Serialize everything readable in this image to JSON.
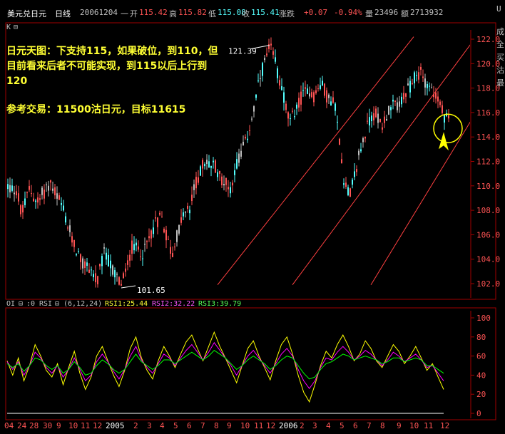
{
  "header": {
    "symbol_name": "美元兑日元",
    "period": "日线",
    "date": "20061204",
    "sep": "一",
    "open_label": "开",
    "open": "115.42",
    "high_label": "高",
    "high": "115.82",
    "low_label": "低",
    "low": "115.08",
    "close_label": "收",
    "close": "115.41",
    "change_label": "涨跌",
    "change": "+0.07",
    "change_pct": "-0.94%",
    "volume_label": "量",
    "volume": "23496",
    "amount_label": "额",
    "amount": "2713932"
  },
  "corner": {
    "k_mark": "K",
    "box_glyph": "⊟"
  },
  "right_strip": [
    "U",
    "成",
    "全",
    "买",
    "沽",
    "最"
  ],
  "annotation": {
    "line1": "日元天图：下支持115，如果破位，到110，但",
    "line2": "目前看来后者不可能实现，到115以后上行到",
    "line3": "120",
    "line4": "参考交易：11500沽日元，目标11615"
  },
  "indicator_bar": {
    "oi": "OI",
    "box1": "⊟",
    "zero": ":0",
    "rsi": "RSI",
    "box2": "⊟",
    "params": "(6,12,24)",
    "rsi1_label": "RSI1:25.44",
    "rsi2_label": "RSI2:32.22",
    "rsi3_label": "RSI3:39.79"
  },
  "colors": {
    "up": "#ff5454",
    "down": "#54ffff",
    "neutral": "#c0c0c0",
    "frame": "#a00000",
    "channel": "#ff4040",
    "axis_text": "#ff5454",
    "highlight": "#ffff00",
    "rsi1": "#ffff00",
    "rsi2": "#ff00ff",
    "rsi3": "#00ff00"
  },
  "chart_data": [
    {
      "type": "candlestick",
      "title": "",
      "price_axis": {
        "ticks": [
          "122.0",
          "120.0",
          "118.0",
          "116.0",
          "114.0",
          "112.0",
          "110.0",
          "108.0",
          "106.0",
          "104.0",
          "102.0"
        ],
        "ylim": [
          101.4,
          122.5
        ]
      },
      "labels": {
        "high_mark": "121.39",
        "low_mark": "101.65"
      },
      "price_path": [
        [
          0,
          114.6
        ],
        [
          10,
          110
        ],
        [
          22,
          109.6
        ],
        [
          30,
          107.6
        ],
        [
          40,
          109.8
        ],
        [
          52,
          108.6
        ],
        [
          62,
          109.7
        ],
        [
          70,
          110.2
        ],
        [
          85,
          108.4
        ],
        [
          100,
          105.6
        ],
        [
          115,
          103.6
        ],
        [
          126,
          103.3
        ],
        [
          135,
          102.0
        ],
        [
          145,
          104.5
        ],
        [
          158,
          103.0
        ],
        [
          170,
          101.9
        ],
        [
          185,
          105.1
        ],
        [
          200,
          104.5
        ],
        [
          215,
          106.8
        ],
        [
          225,
          107.6
        ],
        [
          235,
          105.4
        ],
        [
          240,
          104.3
        ],
        [
          255,
          107.6
        ],
        [
          265,
          108.0
        ],
        [
          272,
          110.0
        ],
        [
          285,
          111.9
        ],
        [
          300,
          111.6
        ],
        [
          315,
          110.2
        ],
        [
          322,
          109.8
        ],
        [
          332,
          112.1
        ],
        [
          345,
          113.8
        ],
        [
          355,
          116.3
        ],
        [
          362,
          118.4
        ],
        [
          370,
          120.1
        ],
        [
          378,
          121.3
        ],
        [
          386,
          119.8
        ],
        [
          395,
          117.9
        ],
        [
          405,
          115.0
        ],
        [
          412,
          116.1
        ],
        [
          420,
          117.0
        ],
        [
          430,
          118.0
        ],
        [
          440,
          117.4
        ],
        [
          450,
          118.3
        ],
        [
          460,
          117.1
        ],
        [
          468,
          116.7
        ],
        [
          475,
          113.8
        ],
        [
          482,
          110.1
        ],
        [
          490,
          109.4
        ],
        [
          497,
          111.1
        ],
        [
          505,
          113.1
        ],
        [
          515,
          115.1
        ],
        [
          525,
          116.0
        ],
        [
          535,
          115.1
        ],
        [
          545,
          116.2
        ],
        [
          555,
          116.7
        ],
        [
          565,
          117.0
        ],
        [
          575,
          118.3
        ],
        [
          583,
          118.9
        ],
        [
          590,
          119.4
        ],
        [
          597,
          118.4
        ],
        [
          605,
          117.9
        ],
        [
          612,
          117.0
        ],
        [
          618,
          116.3
        ],
        [
          622,
          115.4
        ]
      ],
      "lows": [
        {
          "candle_x": 170,
          "price": 101.65
        }
      ],
      "highs": [
        {
          "candle_x": 378,
          "price": 121.39
        }
      ],
      "channel_lines": [
        {
          "from": [
            305,
            101.9
          ],
          "to": [
            580,
            122.2
          ]
        },
        {
          "from": [
            410,
            101.9
          ],
          "to": [
            660,
            121.6
          ]
        },
        {
          "from": [
            520,
            101.9
          ],
          "to": [
            660,
            115.3
          ]
        }
      ],
      "highlight_circle": {
        "center": [
          628,
          114.7
        ],
        "label": "target"
      }
    },
    {
      "type": "line",
      "title": "",
      "series": [
        {
          "name": "RSI1",
          "values_note": "oscillator",
          "values": [
            55,
            40,
            58,
            34,
            50,
            72,
            60,
            45,
            38,
            52,
            30,
            48,
            65,
            42,
            25,
            38,
            60,
            70,
            55,
            40,
            28,
            45,
            68,
            80,
            58,
            45,
            36,
            55,
            70,
            60,
            48,
            62,
            75,
            82,
            68,
            55,
            70,
            85,
            70,
            58,
            45,
            32,
            50,
            68,
            76,
            60,
            48,
            35,
            55,
            72,
            80,
            62,
            40,
            22,
            12,
            30,
            50,
            65,
            58,
            72,
            82,
            70,
            55,
            62,
            76,
            68,
            55,
            48,
            60,
            72,
            65,
            52,
            60,
            70,
            58,
            45,
            52,
            38,
            25
          ]
        },
        {
          "name": "RSI2",
          "values": [
            54,
            46,
            54,
            40,
            50,
            64,
            58,
            48,
            42,
            50,
            38,
            46,
            58,
            46,
            34,
            40,
            54,
            62,
            54,
            44,
            36,
            46,
            60,
            70,
            56,
            48,
            42,
            52,
            62,
            58,
            50,
            58,
            66,
            72,
            64,
            56,
            64,
            74,
            66,
            58,
            50,
            40,
            50,
            60,
            66,
            58,
            50,
            42,
            52,
            62,
            68,
            60,
            46,
            34,
            26,
            34,
            48,
            58,
            56,
            64,
            70,
            64,
            56,
            60,
            66,
            62,
            56,
            50,
            56,
            64,
            60,
            54,
            58,
            62,
            56,
            48,
            50,
            42,
            34
          ]
        },
        {
          "name": "RSI3",
          "values": [
            52,
            48,
            52,
            44,
            50,
            58,
            56,
            50,
            46,
            50,
            42,
            46,
            54,
            48,
            40,
            42,
            50,
            56,
            52,
            46,
            42,
            46,
            54,
            62,
            54,
            50,
            46,
            50,
            56,
            56,
            52,
            56,
            60,
            64,
            60,
            56,
            60,
            66,
            62,
            58,
            52,
            46,
            50,
            56,
            60,
            56,
            52,
            46,
            50,
            56,
            60,
            58,
            50,
            42,
            36,
            38,
            46,
            52,
            54,
            58,
            62,
            60,
            56,
            58,
            60,
            58,
            56,
            52,
            54,
            58,
            58,
            54,
            56,
            58,
            56,
            50,
            50,
            46,
            42
          ]
        }
      ],
      "ylim": [
        0,
        100
      ],
      "y_ticks": [
        "100",
        "80",
        "60",
        "40",
        "20",
        "0"
      ]
    }
  ],
  "x_axis": {
    "labels": [
      "04",
      "24",
      "28",
      "30",
      "9",
      "10",
      "11",
      "12",
      "2005",
      "2",
      "3",
      "4",
      "5",
      "6",
      "7",
      "8",
      "9",
      "10",
      "11",
      "12",
      "2006",
      "2",
      "3",
      "4",
      "5",
      "6",
      "7",
      "8",
      "9",
      "10",
      "11",
      "12"
    ]
  }
}
